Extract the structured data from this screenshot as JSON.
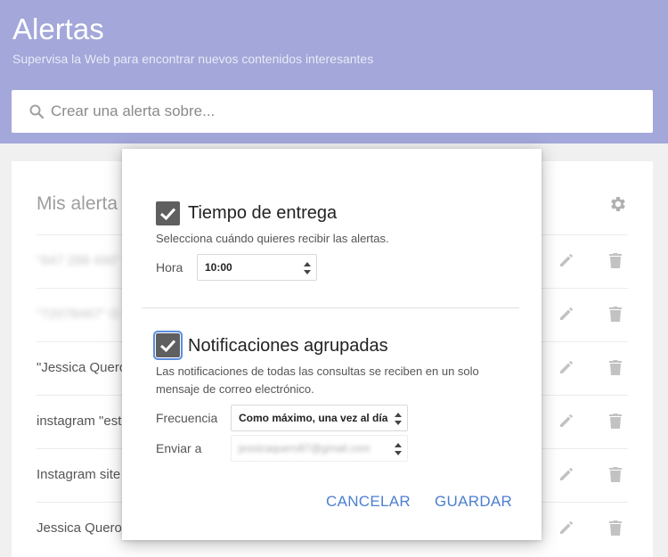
{
  "header": {
    "title": "Alertas",
    "subtitle": "Supervisa la Web para encontrar nuevos contenidos interesantes"
  },
  "search": {
    "placeholder": "Crear una alerta sobre...",
    "icon": "search-icon"
  },
  "alerts_card": {
    "title": "Mis alerta",
    "rows": [
      {
        "text": "\"647 288 490\"",
        "blurred": true
      },
      {
        "text": "\"72078467\" O",
        "blurred": true
      },
      {
        "text": "\"Jessica Quero",
        "blurred": false
      },
      {
        "text": "instagram \"est",
        "blurred": false
      },
      {
        "text": "Instagram site",
        "blurred": false
      },
      {
        "text": "Jessica Quero",
        "blurred": false
      }
    ]
  },
  "dialog": {
    "delivery": {
      "title": "Tiempo de entrega",
      "description": "Selecciona cuándo quieres recibir las alertas.",
      "hour_label": "Hora",
      "hour_value": "10:00",
      "checked": true
    },
    "digest": {
      "title": "Notificaciones agrupadas",
      "description_line1": "Las notificaciones de todas las consultas se reciben en un solo",
      "description_line2": "mensaje de correo electrónico.",
      "frequency_label": "Frecuencia",
      "frequency_value": "Como máximo, una vez al día",
      "send_to_label": "Enviar a",
      "send_to_value": "jessicaquero87@gmail.com",
      "checked": true
    },
    "cancel_label": "CANCELAR",
    "save_label": "GUARDAR"
  },
  "colors": {
    "header_bg": "#a3a7d9",
    "accent_blue": "#4c7fd1",
    "checkbox": "#5f5f5f"
  }
}
